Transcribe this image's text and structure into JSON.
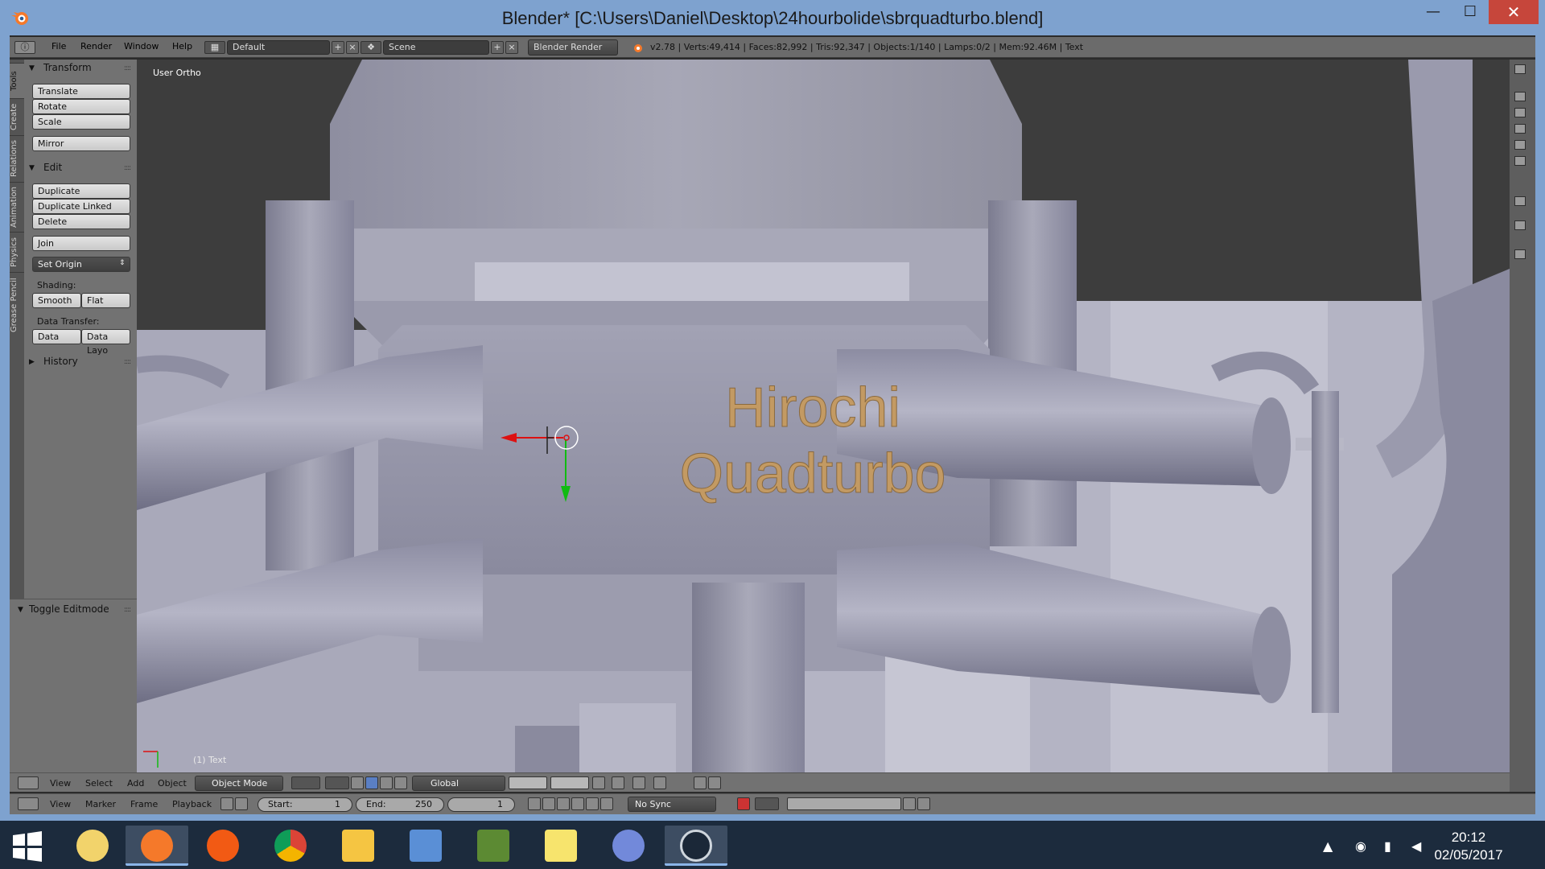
{
  "window": {
    "title": "Blender* [C:\\Users\\Daniel\\Desktop\\24hourbolide\\sbrquadturbo.blend]",
    "minimize": "—",
    "maximize": "☐",
    "close": "✕"
  },
  "info_header": {
    "menus": [
      "File",
      "Render",
      "Window",
      "Help"
    ],
    "layout": "Default",
    "scene": "Scene",
    "engine": "Blender Render",
    "stats": "v2.78 | Verts:49,414 | Faces:82,992 | Tris:92,347 | Objects:1/140 | Lamps:0/2 | Mem:92.46M | Text"
  },
  "tabs": [
    "Tools",
    "Create",
    "Relations",
    "Animation",
    "Physics",
    "Grease Pencil"
  ],
  "toolshelf": {
    "transform": {
      "title": "Transform",
      "buttons": [
        "Translate",
        "Rotate",
        "Scale",
        "Mirror"
      ]
    },
    "edit": {
      "title": "Edit",
      "buttons": [
        "Duplicate",
        "Duplicate Linked",
        "Delete",
        "Join"
      ],
      "set_origin": "Set Origin",
      "shading_label": "Shading:",
      "smooth": "Smooth",
      "flat": "Flat",
      "data_transfer_label": "Data Transfer:",
      "data": "Data",
      "data_layo": "Data Layo"
    },
    "history": "History",
    "toggle_editmode": "Toggle Editmode"
  },
  "viewport": {
    "view_label": "User Ortho",
    "object_label": "(1) Text",
    "text_line1": "Hirochi",
    "text_line2": "Quadturbo"
  },
  "view_header": {
    "menus": [
      "View",
      "Select",
      "Add",
      "Object"
    ],
    "mode": "Object Mode",
    "orientation": "Global"
  },
  "timeline": {
    "menus": [
      "View",
      "Marker",
      "Frame",
      "Playback"
    ],
    "start_label": "Start:",
    "start": "1",
    "end_label": "End:",
    "end": "250",
    "current": "1",
    "sync": "No Sync"
  },
  "taskbar": {
    "time": "20:12",
    "date": "02/05/2017"
  },
  "colors": {
    "titlebar": "#7ea2cf",
    "close": "#c6463b",
    "text_object": "#c39a63",
    "taskbar": "#1c2b3d"
  }
}
